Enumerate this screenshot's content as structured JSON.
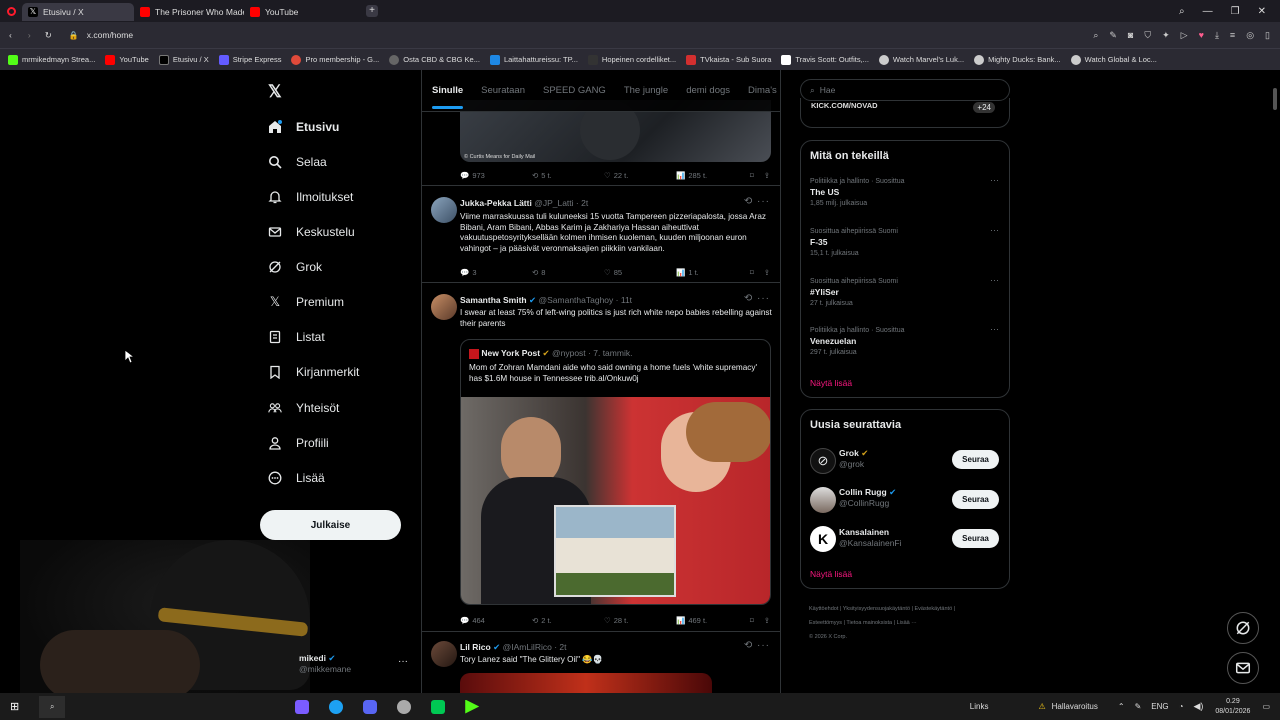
{
  "browser": {
    "tabs": [
      {
        "title": "Etusivu / X",
        "active": true
      },
      {
        "title": "The Prisoner Who Made t",
        "active": false
      },
      {
        "title": "YouTube",
        "active": false
      }
    ],
    "url": "x.com/home",
    "bookmarks": [
      "mrmikedmayn Strea...",
      "YouTube",
      "Etusivu / X",
      "Stripe Express",
      "Pro membership - G...",
      "Osta CBD & CBG Ke...",
      "Laittahattureissu: TP...",
      "Hopeinen cordelliket...",
      "TVkaista - Sub Suora",
      "Travis Scott: Outfits,...",
      "Watch Marvel's Luk...",
      "Mighty Ducks: Bank...",
      "Watch Global & Loc..."
    ]
  },
  "nav": {
    "items": [
      {
        "label": "Etusivu",
        "icon": "home-icon"
      },
      {
        "label": "Selaa",
        "icon": "search-icon"
      },
      {
        "label": "Ilmoitukset",
        "icon": "bell-icon"
      },
      {
        "label": "Keskustelu",
        "icon": "mail-icon"
      },
      {
        "label": "Grok",
        "icon": "grok-icon"
      },
      {
        "label": "Premium",
        "icon": "x-icon"
      },
      {
        "label": "Listat",
        "icon": "list-icon"
      },
      {
        "label": "Kirjanmerkit",
        "icon": "bookmark-icon"
      },
      {
        "label": "Yhteisöt",
        "icon": "people-icon"
      },
      {
        "label": "Profiili",
        "icon": "person-icon"
      },
      {
        "label": "Lisää",
        "icon": "more-circle-icon"
      }
    ],
    "post_label": "Julkaise",
    "account": {
      "name": "mikedi",
      "handle": "@mikkemane"
    }
  },
  "feed": {
    "tabs": [
      "Sinulle",
      "Seurataan",
      "SPEED GANG",
      "The jungle",
      "demi dogs",
      "Dima's Di"
    ],
    "top_image_caption": "© Curtis Means for Daily Mail",
    "top_actions": [
      "973",
      "5 t.",
      "22 t.",
      "285 t."
    ],
    "tweets": [
      {
        "name": "Jukka-Pekka Lätti",
        "handle": "@JP_Latti",
        "time": "· 2t",
        "text": "Viime marraskuussa tuli kuluneeksi 15 vuotta Tampereen pizzeriapalosta, jossa Araz Bibani, Aram Bibani, Abbas Karim ja Zakhariya Hassan aiheuttivat vakuutuspetosyrityksellään kolmen ihmisen kuoleman, kuuden miljoonan euron vahingot – ja pääsivät veronmaksajien piikkiin vankilaan.",
        "actions": [
          "3",
          "8",
          "85",
          "1 t."
        ]
      },
      {
        "name": "Samantha Smith",
        "handle": "@SamanthaTaghoy",
        "time": "· 11t",
        "text": "I swear at least 75% of left-wing politics is just rich white nepo babies rebelling against their parents",
        "quote": {
          "name": "New York Post",
          "handle": "@nypost",
          "time": "· 7. tammik.",
          "text": "Mom of Zohran Mamdani aide who said owning a home fuels 'white supremacy' has $1.6M house in Tennessee trib.al/Onkuw0j"
        },
        "actions": [
          "464",
          "2 t.",
          "28 t.",
          "469 t."
        ]
      },
      {
        "name": "Lil Rico",
        "handle": "@IAmLilRico",
        "time": "· 2t",
        "text": "Tory Lanez said \"The Glittery Oil\" 😂💀"
      }
    ]
  },
  "right": {
    "search_placeholder": "Hae",
    "top_snippet": "KICK.COM/NOVAD",
    "top_badge": "+24",
    "trends_title": "Mitä on tekeillä",
    "trends": [
      {
        "context": "Politiikka ja hallinto · Suosittua",
        "title": "The US",
        "count": "1,85 milj. julkaisua"
      },
      {
        "context": "Suosittua aihepiirissä Suomi",
        "title": "F-35",
        "count": "15,1 t. julkaisua"
      },
      {
        "context": "Suosittua aihepiirissä Suomi",
        "title": "#YliSer",
        "count": "27 t. julkaisua"
      },
      {
        "context": "Politiikka ja hallinto · Suosittua",
        "title": "Venezuelan",
        "count": "297 t. julkaisua"
      }
    ],
    "show_more": "Näytä lisää",
    "who_title": "Uusia seurattavia",
    "who": [
      {
        "name": "Grok",
        "handle": "@grok"
      },
      {
        "name": "Collin Rugg",
        "handle": "@CollinRugg"
      },
      {
        "name": "Kansalainen",
        "handle": "@KansalainenFi"
      }
    ],
    "follow_label": "Seuraa",
    "footer": [
      "Käyttöehdot",
      "Yksityisyydensuojakäytäntö",
      "Evästekäytäntö",
      "Esteettömyys",
      "Tietoa mainoksista",
      "Lisää ···",
      "© 2026 X Corp."
    ]
  },
  "taskbar": {
    "links": "Links",
    "weather": "Hallavaroitus",
    "lang": "ENG",
    "time": "0.29",
    "date": "08/01/2026"
  },
  "colors": {
    "accent": "#1d9bf0",
    "pink": "#f91880",
    "bg": "#000000",
    "border": "#2f3336"
  }
}
